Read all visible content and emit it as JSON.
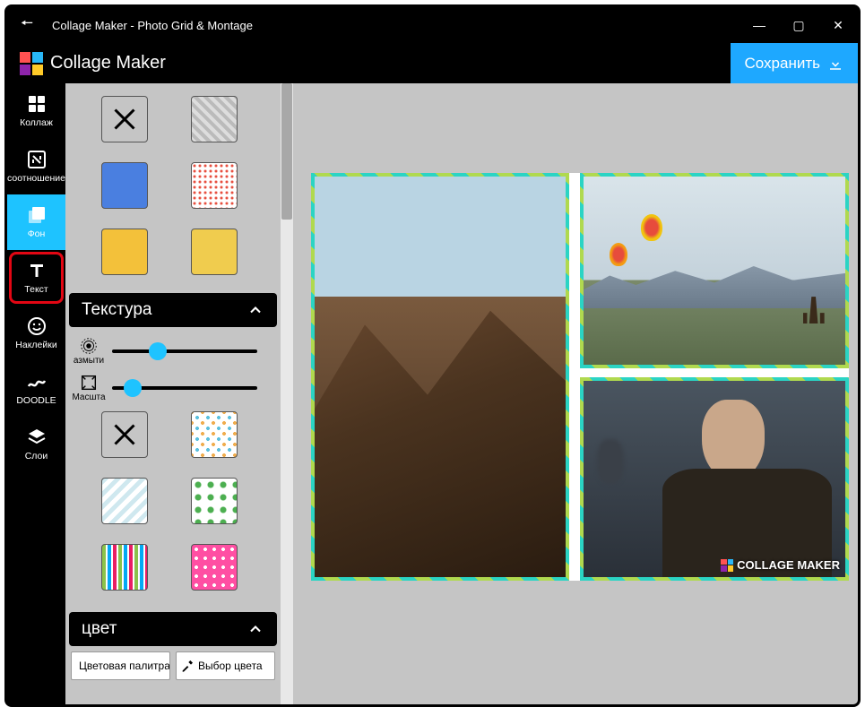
{
  "window": {
    "title": "Collage Maker - Photo Grid & Montage"
  },
  "app": {
    "name": "Collage Maker",
    "save_label": "Сохранить",
    "watermark": "COLLAGE MAKER"
  },
  "nav": {
    "items": [
      {
        "id": "collage",
        "label": "Коллаж"
      },
      {
        "id": "ratio",
        "label": "соотношение"
      },
      {
        "id": "background",
        "label": "Фон"
      },
      {
        "id": "text",
        "label": "Текст"
      },
      {
        "id": "stickers",
        "label": "Наклейки"
      },
      {
        "id": "doodle",
        "label": "DOODLE"
      },
      {
        "id": "layers",
        "label": "Слои"
      }
    ],
    "active": "background",
    "highlight": "text"
  },
  "panel": {
    "sections": {
      "texture": {
        "label": "Текстура"
      },
      "color": {
        "label": "цвет"
      }
    },
    "sliders": {
      "blur": {
        "label": "азмыти",
        "value": 25
      },
      "scale": {
        "label": "Масшта",
        "value": 8
      }
    },
    "color_buttons": {
      "palette": "Цветовая палитра",
      "picker": "Выбор цвета"
    },
    "swatches_top": [
      "none",
      "grey-knit",
      "blue-solid",
      "red-dots",
      "yellow-a",
      "yellow-b"
    ],
    "swatches_tex": [
      "none",
      "confetti",
      "zigzag",
      "green-flower",
      "stripes",
      "pink-dots"
    ]
  }
}
